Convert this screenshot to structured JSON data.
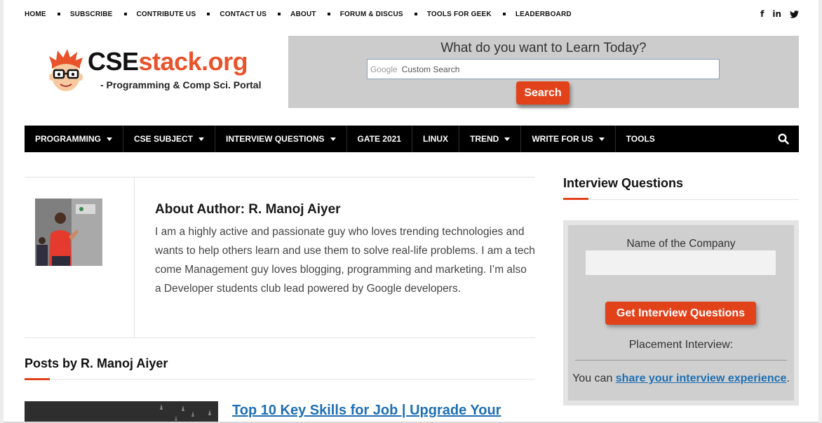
{
  "topnav": {
    "items": [
      "HOME",
      "SUBSCRIBE",
      "CONTRIBUTE US",
      "CONTACT US",
      "ABOUT",
      "FORUM & DISCUS",
      "TOOLS FOR GEEK",
      "LEADERBOARD"
    ]
  },
  "social": {
    "facebook": "f",
    "linkedin": "in"
  },
  "logo": {
    "name_part1": "CSE",
    "name_part2": "stack.org",
    "tagline": "- Programming & Comp Sci. Portal"
  },
  "search": {
    "heading": "What do you want to Learn Today?",
    "google_label": "Google",
    "placeholder": "Custom Search",
    "button_label": "Search"
  },
  "mainnav": {
    "items": [
      {
        "label": "PROGRAMMING",
        "dropdown": true
      },
      {
        "label": "CSE SUBJECT",
        "dropdown": true
      },
      {
        "label": "INTERVIEW QUESTIONS",
        "dropdown": true
      },
      {
        "label": "GATE 2021",
        "dropdown": false
      },
      {
        "label": "LINUX",
        "dropdown": false
      },
      {
        "label": "TREND",
        "dropdown": true
      },
      {
        "label": "WRITE FOR US",
        "dropdown": true
      },
      {
        "label": "TOOLS",
        "dropdown": false
      }
    ]
  },
  "author": {
    "title": "About Author: R. Manoj Aiyer",
    "bio": "I am a highly active and passionate guy who loves trending technologies and wants to help others learn and use them to solve real-life problems. I am a tech come Management guy loves blogging, programming and marketing. I’m also a Developer students club lead powered by Google developers."
  },
  "posts": {
    "heading": "Posts by R. Manoj Aiyer",
    "first_title": "Top 10 Key Skills for Job | Upgrade Your"
  },
  "sidebar": {
    "heading": "Interview Questions",
    "company_label": "Name of the Company",
    "button_label": "Get Interview Questions",
    "placement": "Placement Interview:",
    "share_prefix": "You can ",
    "share_link": "share your interview experience",
    "share_suffix": "."
  },
  "colors": {
    "accent": "#e2421a",
    "link": "#1e6fb3",
    "nav_bg": "#000000",
    "search_panel": "#cccccc"
  }
}
